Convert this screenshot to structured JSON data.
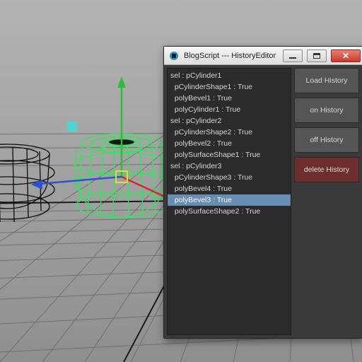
{
  "viewport": {
    "grid_color": "#6f6f6f",
    "axis_x_color": "#d42a2a",
    "axis_y_color": "#2fbc3a",
    "axis_z_color": "#2a52d4",
    "handle_yellow": "#e8d838",
    "handle_cyan": "#3fdada",
    "object_wire_sel": "#2fe85a",
    "object_wire_unsel": "#0a0a0a"
  },
  "dialog": {
    "title": "BlogScript --- HistoryEditor",
    "buttons": {
      "load": "Load History",
      "on": "on  History",
      "off": "off History",
      "delete": "delete History"
    },
    "history": [
      {
        "text": "sel : pCylinder1",
        "indent": 0,
        "selected": false
      },
      {
        "text": "pCylinderShape1 : True",
        "indent": 1,
        "selected": false
      },
      {
        "text": "polyBevel1 : True",
        "indent": 1,
        "selected": false
      },
      {
        "text": "polyCylinder1 : True",
        "indent": 1,
        "selected": false
      },
      {
        "text": "sel : pCylinder2",
        "indent": 0,
        "selected": false
      },
      {
        "text": "pCylinderShape2 : True",
        "indent": 1,
        "selected": false
      },
      {
        "text": "polyBevel2 : True",
        "indent": 1,
        "selected": false
      },
      {
        "text": "polySurfaceShape1 : True",
        "indent": 1,
        "selected": false
      },
      {
        "text": "sel : pCylinder3",
        "indent": 0,
        "selected": false
      },
      {
        "text": "pCylinderShape3 : True",
        "indent": 1,
        "selected": false
      },
      {
        "text": "polyBevel4 : True",
        "indent": 1,
        "selected": false
      },
      {
        "text": "polyBevel3 : True",
        "indent": 1,
        "selected": true
      },
      {
        "text": "polySurfaceShape2 : True",
        "indent": 1,
        "selected": false
      }
    ]
  }
}
